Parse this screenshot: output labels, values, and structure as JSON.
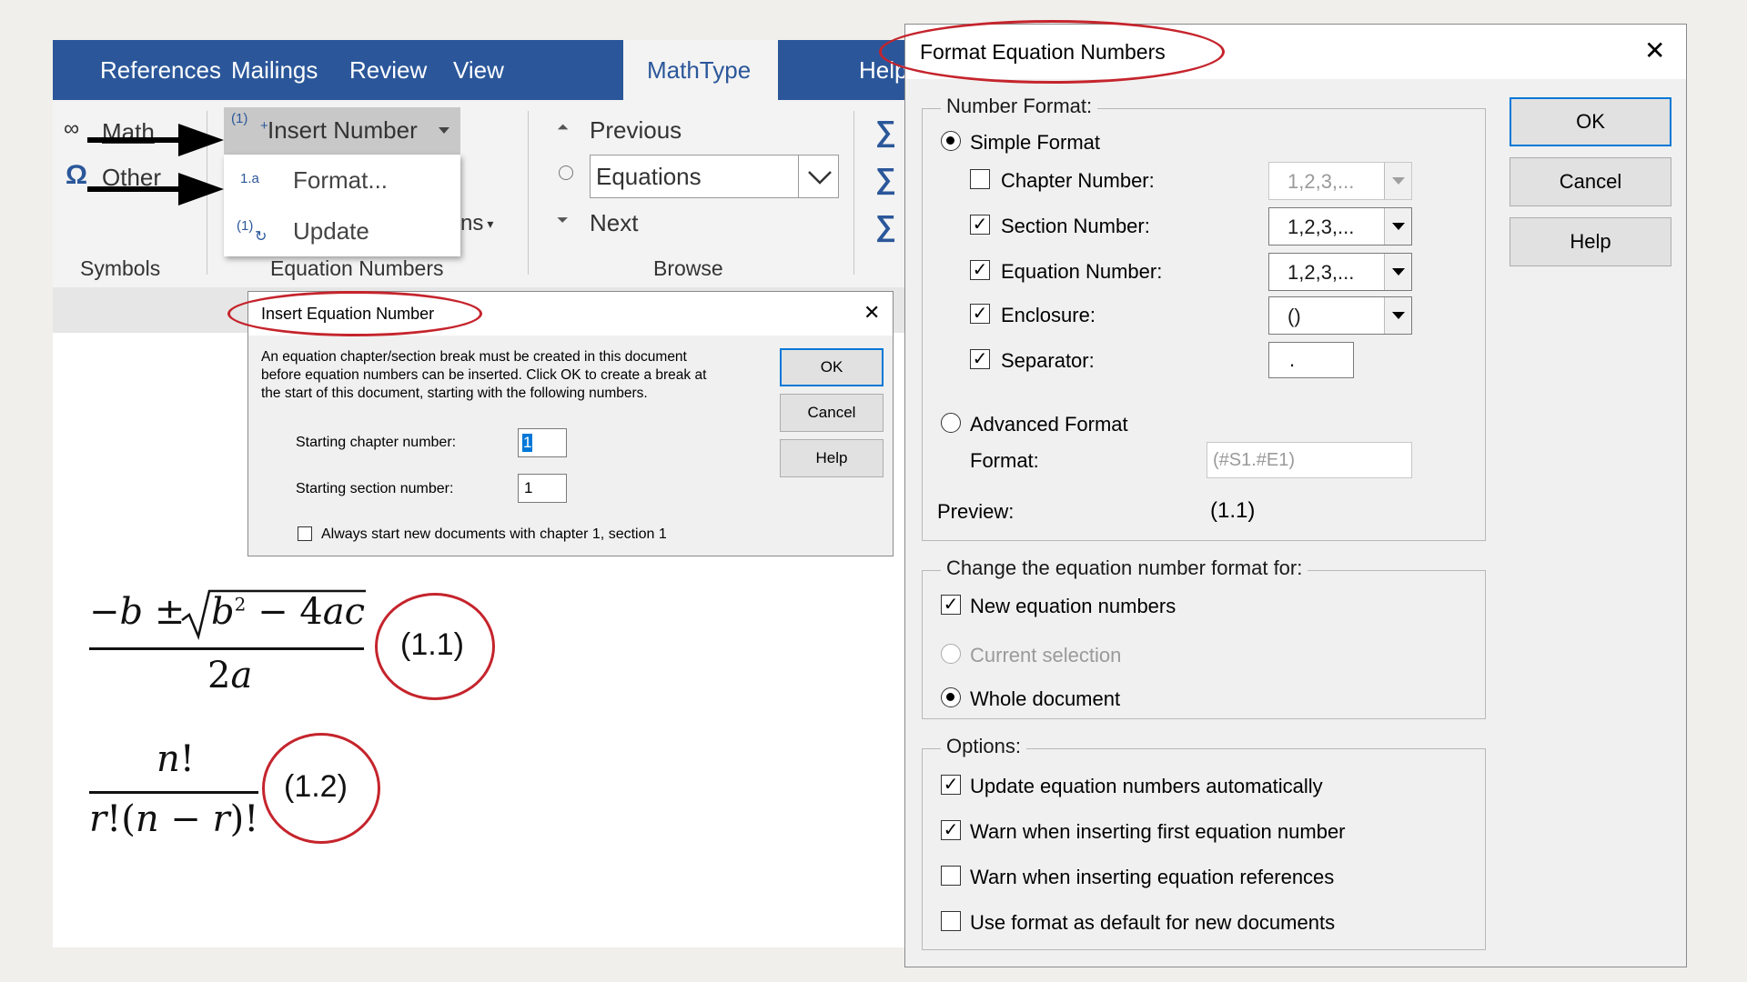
{
  "ribbon": {
    "tabs": [
      "References",
      "Mailings",
      "Review",
      "View",
      "MathType",
      "Help"
    ],
    "active_tab": "MathType",
    "symbols": {
      "math_label": "Math",
      "other_label": "Other",
      "group_label": "Symbols"
    },
    "equation_numbers": {
      "insert_number_label": "Insert Number",
      "insert_number_badge": "(1)",
      "format_label": "Format...",
      "format_badge": "1.a",
      "update_label": "Update",
      "update_badge": "(1)",
      "partial_label": "ns",
      "group_label": "Equation Numbers"
    },
    "browse": {
      "previous_label": "Previous",
      "combo_value": "Equations",
      "next_label": "Next",
      "group_label": "Browse"
    }
  },
  "insert_dialog": {
    "title": "Insert Equation Number",
    "message_lines": [
      "An equation chapter/section break must be created in this document",
      "before equation numbers can be inserted. Click OK to create a break at",
      "the start of this document, starting with the following numbers."
    ],
    "chapter_label": "Starting chapter number:",
    "chapter_value": "1",
    "section_label": "Starting section number:",
    "section_value": "1",
    "always_label": "Always start new documents with chapter 1, section 1",
    "ok_label": "OK",
    "cancel_label": "Cancel",
    "help_label": "Help",
    "close_glyph": "✕"
  },
  "format_dialog": {
    "title": "Format Equation Numbers",
    "close_glyph": "✕",
    "number_format_legend": "Number Format:",
    "simple_format_label": "Simple Format",
    "chapter_label": "Chapter Number:",
    "chapter_value": "1,2,3,...",
    "chapter_checked": false,
    "section_label": "Section Number:",
    "section_value": "1,2,3,...",
    "section_checked": true,
    "equation_label": "Equation Number:",
    "equation_value": "1,2,3,...",
    "equation_checked": true,
    "enclosure_label": "Enclosure:",
    "enclosure_value": "()",
    "enclosure_checked": true,
    "separator_label": "Separator:",
    "separator_value": ".",
    "separator_checked": true,
    "advanced_format_label": "Advanced Format",
    "format_label": "Format:",
    "format_value": "(#S1.#E1)",
    "preview_label": "Preview:",
    "preview_value": "(1.1)",
    "change_legend": "Change the equation number format for:",
    "new_eq_label": "New equation numbers",
    "current_sel_label": "Current selection",
    "whole_doc_label": "Whole document",
    "options_legend": "Options:",
    "opt_update_label": "Update equation numbers automatically",
    "opt_warn_first_label": "Warn when inserting first equation number",
    "opt_warn_refs_label": "Warn when inserting equation references",
    "opt_default_label": "Use format as default for new documents",
    "ok_label": "OK",
    "cancel_label": "Cancel",
    "help_label": "Help"
  },
  "equations": [
    {
      "number": "(1.1)"
    },
    {
      "number": "(1.2)"
    }
  ],
  "colors": {
    "ribbon_blue": "#2b579a",
    "annotation_red": "#c5242c"
  }
}
